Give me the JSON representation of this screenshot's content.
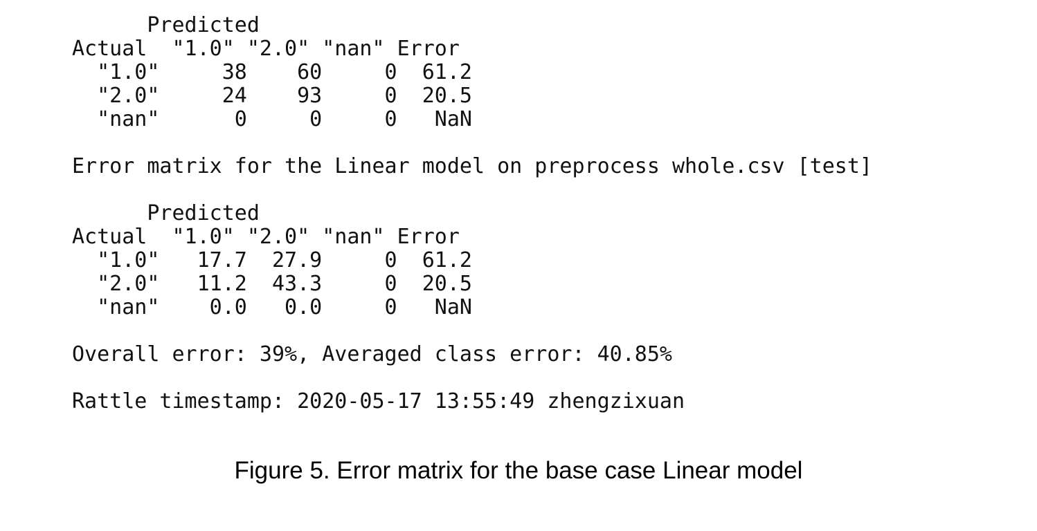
{
  "console": {
    "lines": [
      "      Predicted",
      "Actual  \"1.0\" \"2.0\" \"nan\" Error",
      "  \"1.0\"     38    60     0  61.2",
      "  \"2.0\"     24    93     0  20.5",
      "  \"nan\"      0     0     0   NaN",
      "",
      "Error matrix for the Linear model on preprocess whole.csv [test]",
      "",
      "      Predicted",
      "Actual  \"1.0\" \"2.0\" \"nan\" Error",
      "  \"1.0\"   17.7  27.9     0  61.2",
      "  \"2.0\"   11.2  43.3     0  20.5",
      "  \"nan\"    0.0   0.0     0   NaN",
      "",
      "Overall error: 39%, Averaged class error: 40.85%",
      "",
      "Rattle timestamp: 2020-05-17 13:55:49 zhengzixuan",
      "=================================================================="
    ]
  },
  "caption": "Figure 5. Error matrix for the base case Linear model"
}
